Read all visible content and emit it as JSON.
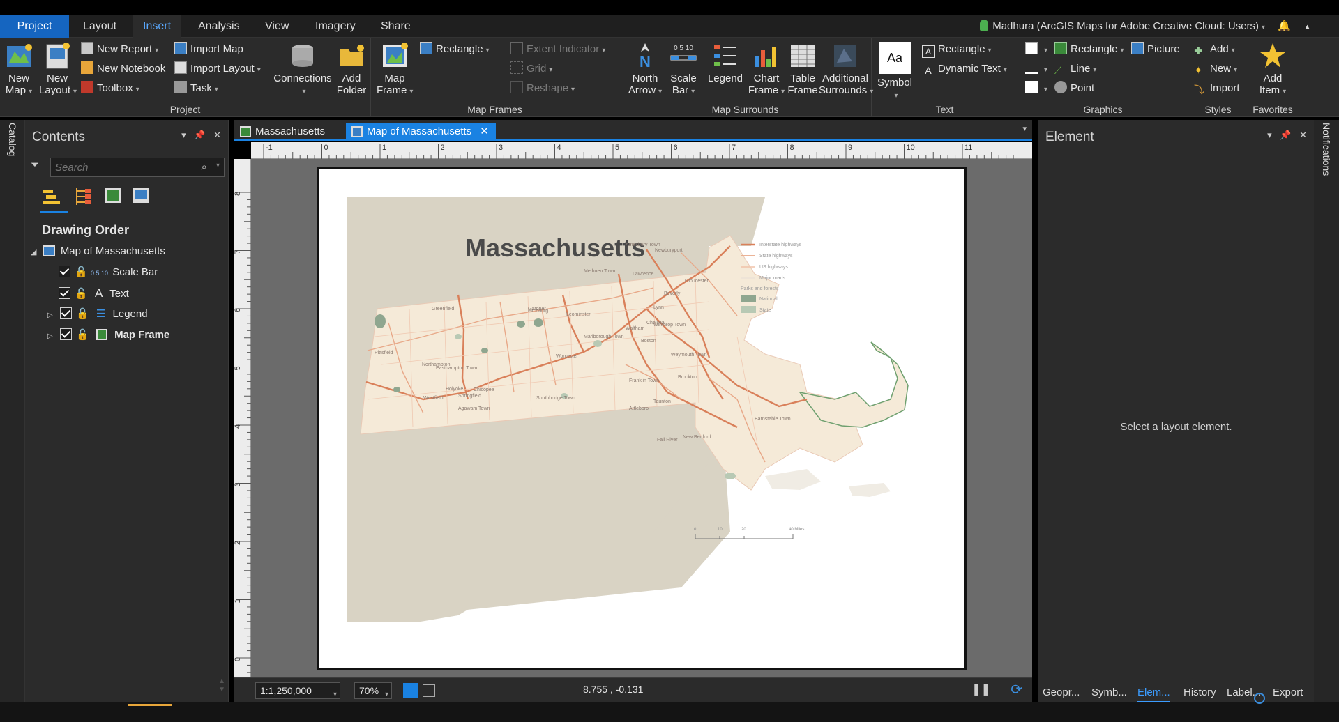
{
  "ribbon_tabs": [
    "Project",
    "Layout",
    "Insert",
    "Analysis",
    "View",
    "Imagery",
    "Share"
  ],
  "active_tab": "Insert",
  "user": "Madhura (ArcGIS Maps for Adobe Creative Cloud: Users)",
  "groups": {
    "project": {
      "label": "Project",
      "new_map": "New\nMap",
      "new_map_l1": "New",
      "new_map_l2": "Map",
      "new_layout_l1": "New",
      "new_layout_l2": "Layout",
      "new_report": "New Report",
      "new_notebook": "New Notebook",
      "toolbox": "Toolbox",
      "import_map": "Import Map",
      "import_layout": "Import Layout",
      "task": "Task",
      "connections": "Connections",
      "add_folder_l1": "Add",
      "add_folder_l2": "Folder"
    },
    "map_frames": {
      "label": "Map Frames",
      "map_frame_l1": "Map",
      "map_frame_l2": "Frame",
      "rectangle": "Rectangle",
      "extent_indicator": "Extent Indicator",
      "grid": "Grid",
      "reshape": "Reshape"
    },
    "map_surrounds": {
      "label": "Map Surrounds",
      "north_arrow_l1": "North",
      "north_arrow_l2": "Arrow",
      "scale_bar_l1": "Scale",
      "scale_bar_l2": "Bar",
      "scale_bar_icon": "0 5 10",
      "legend": "Legend",
      "chart_frame_l1": "Chart",
      "chart_frame_l2": "Frame",
      "table_frame_l1": "Table",
      "table_frame_l2": "Frame",
      "additional_l1": "Additional",
      "additional_l2": "Surrounds"
    },
    "text": {
      "label": "Text",
      "symbol": "Symbol",
      "symbol_preview": "Aa",
      "rectangle": "Rectangle",
      "dynamic_text": "Dynamic Text"
    },
    "graphics": {
      "label": "Graphics",
      "rectangle": "Rectangle",
      "line": "Line",
      "point": "Point",
      "picture": "Picture"
    },
    "styles": {
      "label": "Styles",
      "add": "Add",
      "new": "New",
      "import": "Import"
    },
    "favorites": {
      "label": "Favorites",
      "add_item_l1": "Add",
      "add_item_l2": "Item"
    }
  },
  "side_strips": {
    "catalog": "Catalog",
    "notifications": "Notifications"
  },
  "contents": {
    "title": "Contents",
    "search_placeholder": "Search",
    "section": "Drawing Order",
    "root": "Map of Massachusetts",
    "items": [
      "Scale Bar",
      "Text",
      "Legend",
      "Map Frame"
    ]
  },
  "doc_tabs": [
    "Massachusetts",
    "Map of Massachusetts"
  ],
  "ruler_h": [
    "-1",
    "0",
    "1",
    "2",
    "3",
    "4",
    "5",
    "6",
    "7",
    "8",
    "9",
    "10",
    "11"
  ],
  "ruler_v": [
    "8",
    "7",
    "6",
    "5",
    "4",
    "3",
    "2",
    "1",
    "0"
  ],
  "map": {
    "title": "Massachusetts",
    "legend": [
      "Interstate highways",
      "State highways",
      "US highways",
      "Major roads",
      "Parks and forests",
      "National",
      "State"
    ],
    "scale_labels": [
      "0",
      "10",
      "20",
      "40 Miles"
    ],
    "towns": [
      "Amesbury Town",
      "Newburyport",
      "Methuen Town",
      "Lawrence",
      "Gloucester",
      "Beverly",
      "Lynn",
      "Fitchburg",
      "Gardner",
      "Leominster",
      "Greenfield",
      "Marlborough Town",
      "Chelsea",
      "Winthrop Town",
      "Waltham",
      "Boston",
      "Pittsfield",
      "Northampton",
      "Easthampton Town",
      "Holyoke",
      "Chicopee",
      "Springfield",
      "Westfield",
      "Agawam Town",
      "Worcester",
      "Southbridge Town",
      "Franklin Town",
      "Weymouth Town",
      "Brockton",
      "Attleboro",
      "Taunton",
      "Fall River",
      "New Bedford",
      "Barnstable Town"
    ],
    "colors": {
      "land": "#d9d3c4",
      "state": "#f5ead8",
      "interstate": "#d9805a",
      "state_hwy": "#e8a888",
      "us_hwy": "#f0c2a8",
      "major": "#f2d6c6",
      "park_national": "#8fa68f",
      "park_state": "#b8c9b4",
      "water": "#ffffff"
    }
  },
  "status": {
    "scale": "1:1,250,000",
    "zoom": "70%",
    "coords": "8.755 , -0.131"
  },
  "element_pane": {
    "title": "Element",
    "empty_message": "Select a layout element."
  },
  "bottom_tabs": [
    "Geopr...",
    "Symb...",
    "Elem...",
    "History",
    "Label...",
    "Export"
  ],
  "active_bottom_tab": "Elem..."
}
